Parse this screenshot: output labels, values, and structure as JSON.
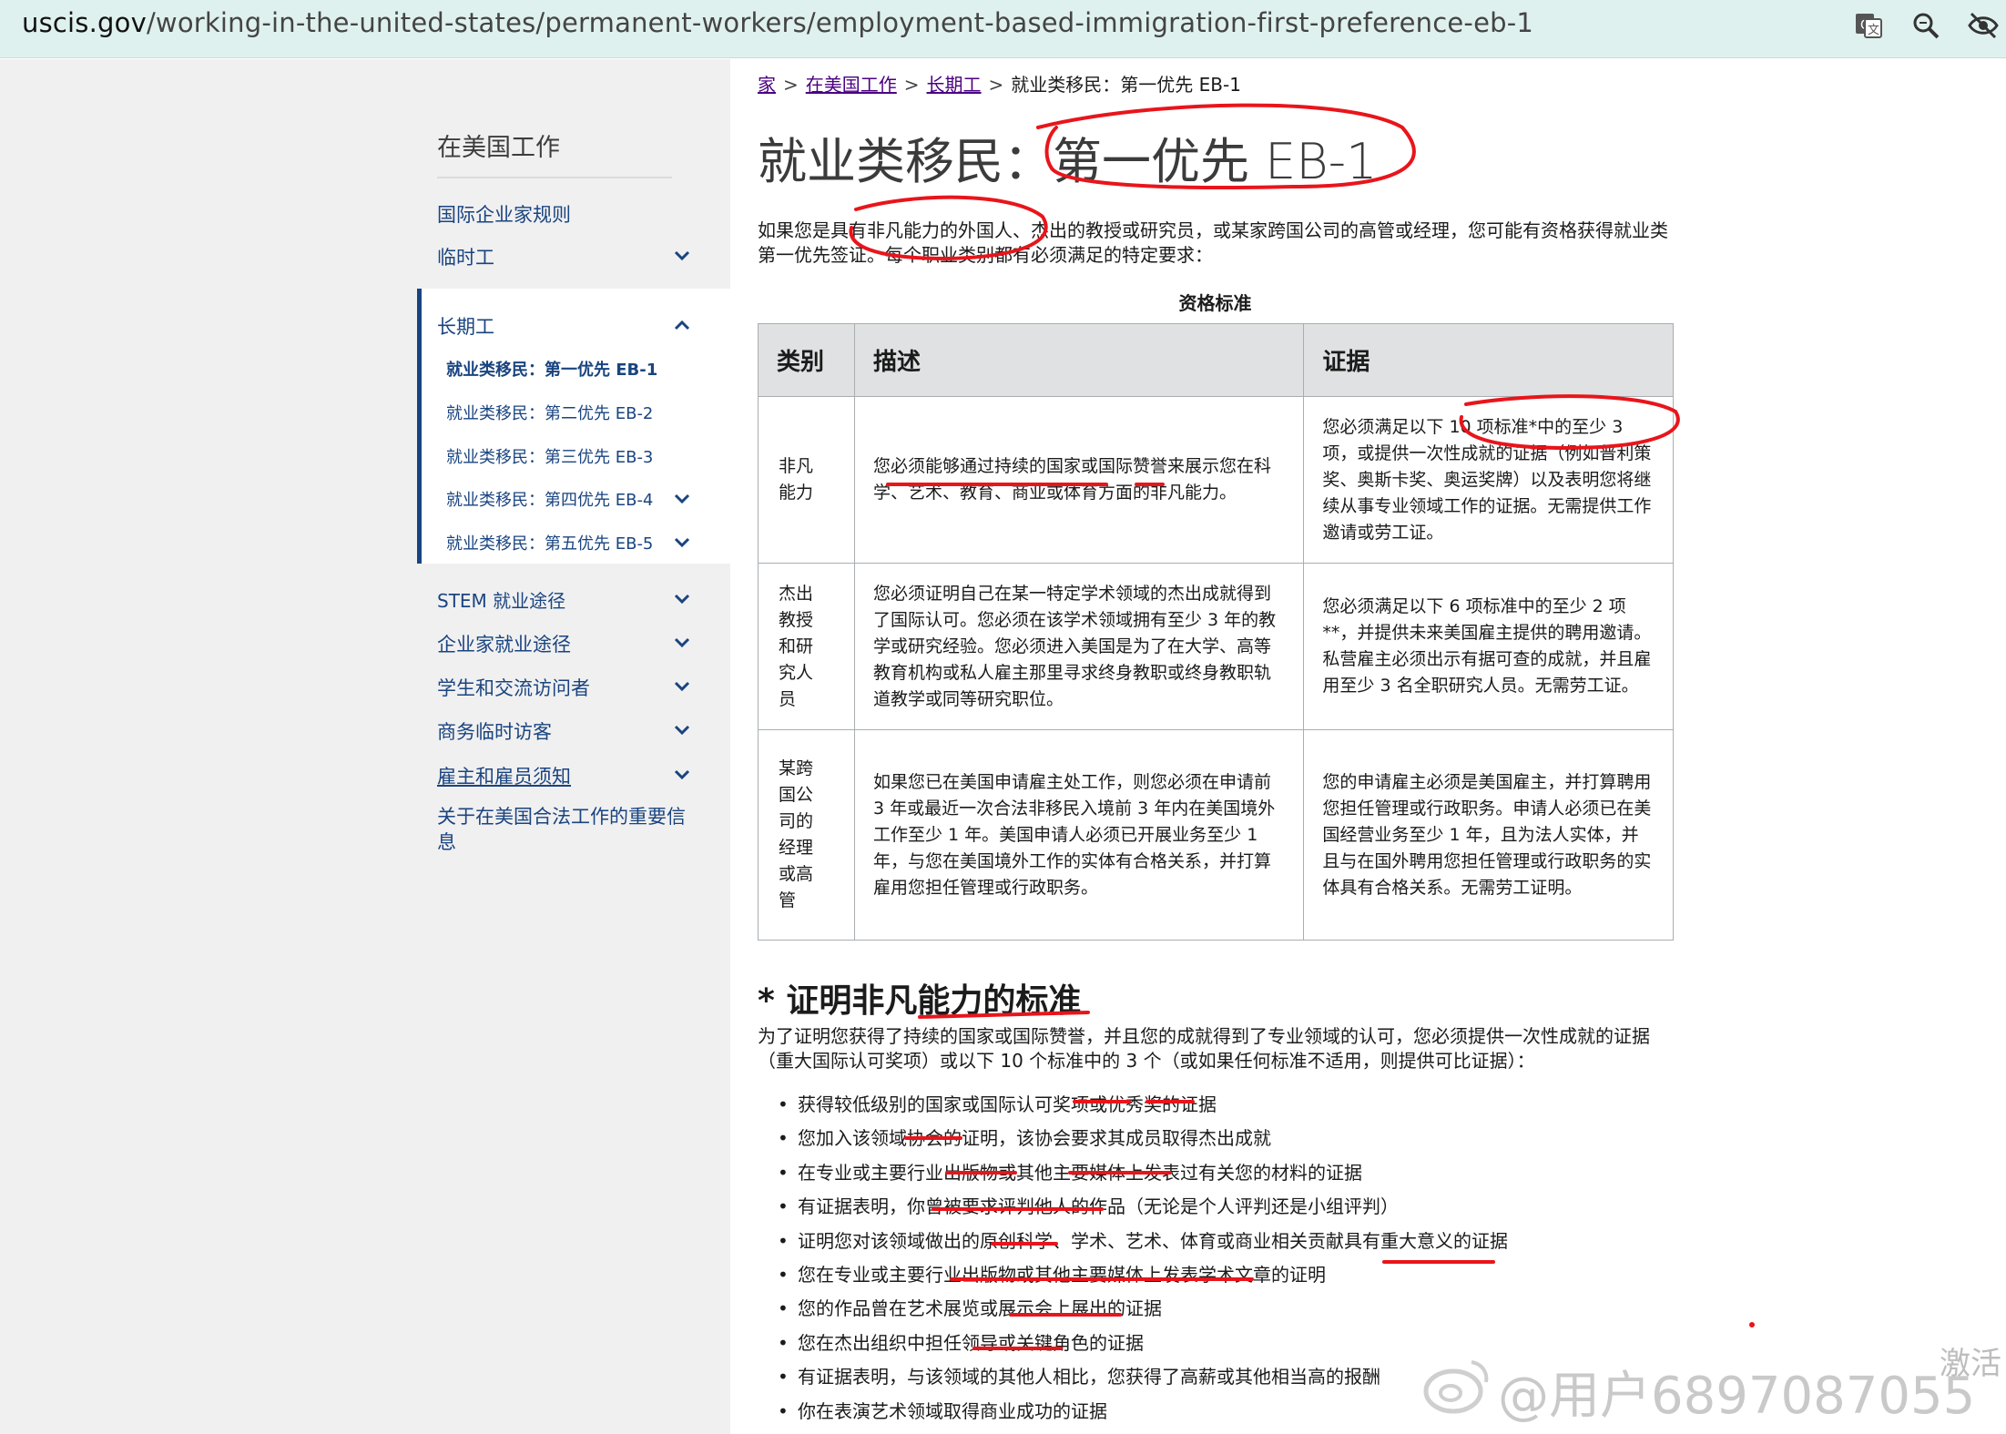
{
  "browser": {
    "url_domain": "uscis.gov",
    "url_path": "/working-in-the-united-states/permanent-workers/employment-based-immigration-first-preference-eb-1",
    "icons": [
      "translate-icon",
      "zoom-icon",
      "eye-off-icon"
    ]
  },
  "breadcrumb": {
    "home": "家",
    "working": "在美国工作",
    "permanent": "长期工",
    "current": "就业类移民：第一优先 EB-1"
  },
  "sidebar": {
    "title": "在美国工作",
    "items_top": [
      {
        "label": "国际企业家规则"
      },
      {
        "label": "临时工"
      }
    ],
    "active_label": "长期工",
    "sub_items": [
      {
        "label": "就业类移民：第一优先 EB-1"
      },
      {
        "label": "就业类移民：第二优先 EB-2"
      },
      {
        "label": "就业类移民：第三优先 EB-3"
      },
      {
        "label": "就业类移民：第四优先 EB-4"
      },
      {
        "label": "就业类移民：第五优先 EB-5"
      }
    ],
    "items_bottom": [
      {
        "label": "STEM 就业途径"
      },
      {
        "label": "企业家就业途径"
      },
      {
        "label": "学生和交流访问者"
      },
      {
        "label": "商务临时访客"
      },
      {
        "label": "雇主和雇员须知"
      },
      {
        "label": "关于在美国合法工作的重要信息"
      }
    ]
  },
  "main": {
    "title": "就业类移民：第一优先 EB-1",
    "intro": "如果您是具有非凡能力的外国人、杰出的教授或研究员，或某家跨国公司的高管或经理，您可能有资格获得就业类第一优先签证。每个职业类别都有必须满足的特定要求：",
    "table_caption": "资格标准",
    "table": {
      "headers": [
        "类别",
        "描述",
        "证据"
      ],
      "rows": [
        {
          "category": "非凡能力",
          "description": "您必须能够通过持续的国家或国际赞誉来展示您在科学、艺术、教育、商业或体育方面的非凡能力。",
          "evidence": "您必须满足以下 10 项标准*中的至少 3 项，或提供一次性成就的证据（例如普利策奖、奥斯卡奖、奥运奖牌）以及表明您将继续从事专业领域工作的证据。无需提供工作邀请或劳工证。"
        },
        {
          "category": "杰出教授和研究人员",
          "description": "您必须证明自己在某一特定学术领域的杰出成就得到了国际认可。您必须在该学术领域拥有至少 3 年的教学或研究经验。您必须进入美国是为了在大学、高等教育机构或私人雇主那里寻求终身教职或终身教职轨道教学或同等研究职位。",
          "evidence": "您必须满足以下 6 项标准中的至少 2 项**，并提供未来美国雇主提供的聘用邀请。私营雇主必须出示有据可查的成就，并且雇用至少 3 名全职研究人员。无需劳工证。"
        },
        {
          "category": "某跨国公司的经理或高管",
          "description": "如果您已在美国申请雇主处工作，则您必须在申请前 3 年或最近一次合法非移民入境前 3 年内在美国境外工作至少 1 年。美国申请人必须已开展业务至少 1 年，与您在美国境外工作的实体有合格关系，并打算雇用您担任管理或行政职务。",
          "evidence": "您的申请雇主必须是美国雇主，并打算聘用您担任管理或行政职务。申请人必须已在美国经营业务至少 1 年，且为法人实体，并且与在国外聘用您担任管理或行政职务的实体具有合格关系。无需劳工证明。"
        }
      ]
    },
    "section_heading": "* 证明非凡能力的标准",
    "section_intro": "为了证明您获得了持续的国家或国际赞誉，并且您的成就得到了专业领域的认可，您必须提供一次性成就的证据（重大国际认可奖项）或以下 10 个标准中的 3 个（或如果任何标准不适用，则提供可比证据）：",
    "criteria": [
      "获得较低级别的国家或国际认可奖项或优秀奖的证据",
      "您加入该领域协会的证明，该协会要求其成员取得杰出成就",
      "在专业或主要行业出版物或其他主要媒体上发表过有关您的材料的证据",
      "有证据表明，你曾被要求评判他人的作品（无论是个人评判还是小组评判）",
      "证明您对该领域做出的原创科学、学术、艺术、体育或商业相关贡献具有重大意义的证据",
      "您在专业或主要行业出版物或其他主要媒体上发表学术文章的证明",
      "您的作品曾在艺术展览或展示会上展出的证据",
      "您在杰出组织中担任领导或关键角色的证据",
      "有证据表明，与该领域的其他人相比，您获得了高薪或其他相当高的报酬",
      "你在表演艺术领域取得商业成功的证据"
    ]
  },
  "overlay": {
    "watermark": "@用户6897087055",
    "activate_text": "激活",
    "mark_color": "#e8151b"
  }
}
